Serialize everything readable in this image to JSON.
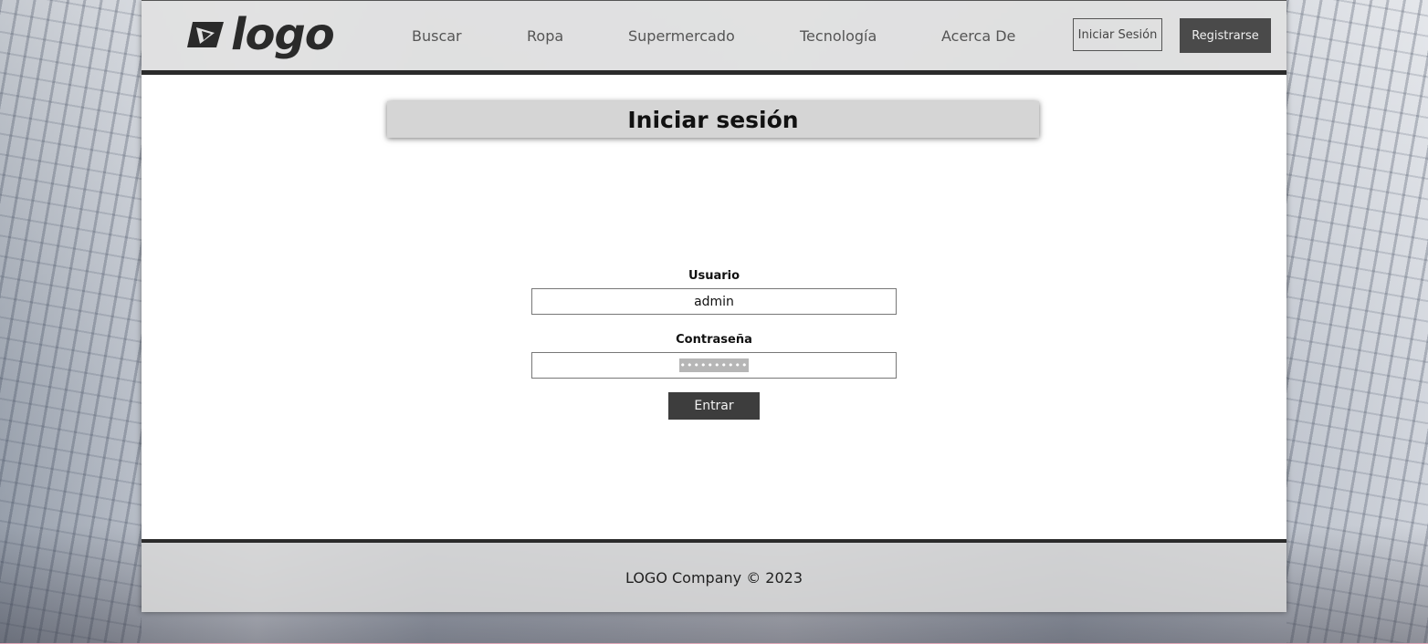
{
  "header": {
    "logo_text": "logo",
    "nav": [
      "Buscar",
      "Ropa",
      "Supermercado",
      "Tecnología",
      "Acerca De"
    ],
    "login_label": "Iniciar Sesión",
    "register_label": "Registrarse"
  },
  "main": {
    "title": "Iniciar sesión",
    "username_label": "Usuario",
    "username_value": "admin",
    "password_label": "Contraseña",
    "password_mask": "••••••••••",
    "submit_label": "Entrar"
  },
  "footer": {
    "text": "LOGO Company © 2023"
  },
  "colors": {
    "header_bg": "#e1e1e1",
    "border_dark": "#2b2b2b",
    "button_dark": "#3d3d3d",
    "register_bg": "#4a4a4a"
  }
}
